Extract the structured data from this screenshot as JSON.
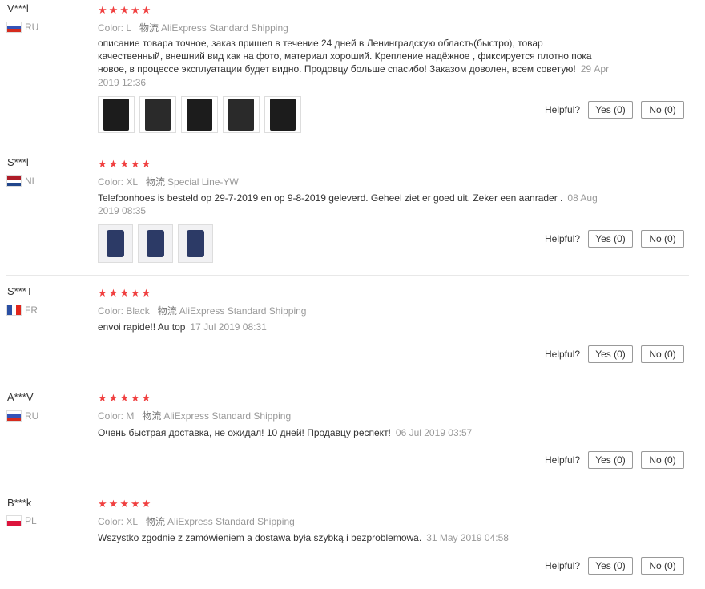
{
  "reviews": [
    {
      "user": "V***l",
      "country": "RU",
      "flag": [
        "#ffffff",
        "#3453b8",
        "#d52b1e"
      ],
      "color": "Color: L",
      "shipping_key": "物流",
      "shipping": "AliExpress Standard Shipping",
      "text": "описание товара точное, заказ пришел в течение 24 дней в Ленинградскую область(быстро), товар качественный, внешний вид как на фото, материал хороший. Крепление надёжное , фиксируется плотно пока новое, в процессе эксплуатации будет видно. Продовцу больше спасибо! Заказом доволен, всем советую!",
      "date": "29 Apr 2019 12:36",
      "stars": 5
    },
    {
      "user": "S***l",
      "country": "NL",
      "flag": [
        "#ae1c28",
        "#ffffff",
        "#21468b"
      ],
      "color": "Color: XL",
      "shipping_key": "物流",
      "shipping": "Special Line-YW",
      "text": "Telefoonhoes is besteld op 29-7-2019 en op 9-8-2019 geleverd. Geheel ziet er goed uit. Zeker een aanrader .",
      "date": "08 Aug 2019 08:35",
      "stars": 5
    },
    {
      "user": "S***T",
      "country": "FR",
      "flag": [
        "#2a4fa3",
        "#ffffff",
        "#e1261c"
      ],
      "color": "Color: Black",
      "shipping_key": "物流",
      "shipping": "AliExpress Standard Shipping",
      "text": "envoi rapide!! Au top",
      "date": "17 Jul 2019 08:31",
      "stars": 5
    },
    {
      "user": "A***V",
      "country": "RU",
      "flag": [
        "#ffffff",
        "#3453b8",
        "#d52b1e"
      ],
      "color": "Color: M",
      "shipping_key": "物流",
      "shipping": "AliExpress Standard Shipping",
      "text": "Очень быстрая доставка, не ожидал! 10 дней! Продавцу респект!",
      "date": "06 Jul 2019 03:57",
      "stars": 5
    },
    {
      "user": "B***k",
      "country": "PL",
      "flag": [
        "#ffffff",
        "#dc143c"
      ],
      "color": "Color: XL",
      "shipping_key": "物流",
      "shipping": "AliExpress Standard Shipping",
      "text": "Wszystko zgodnie z zamówieniem a dostawa była szybką i bezproblemowa.",
      "date": "31 May 2019 04:58",
      "stars": 5
    }
  ],
  "helpful_label": "Helpful?",
  "yes_label": "Yes (0)",
  "no_label": "No (0)",
  "star_color": "#f04040",
  "star_icon": "star-icon"
}
